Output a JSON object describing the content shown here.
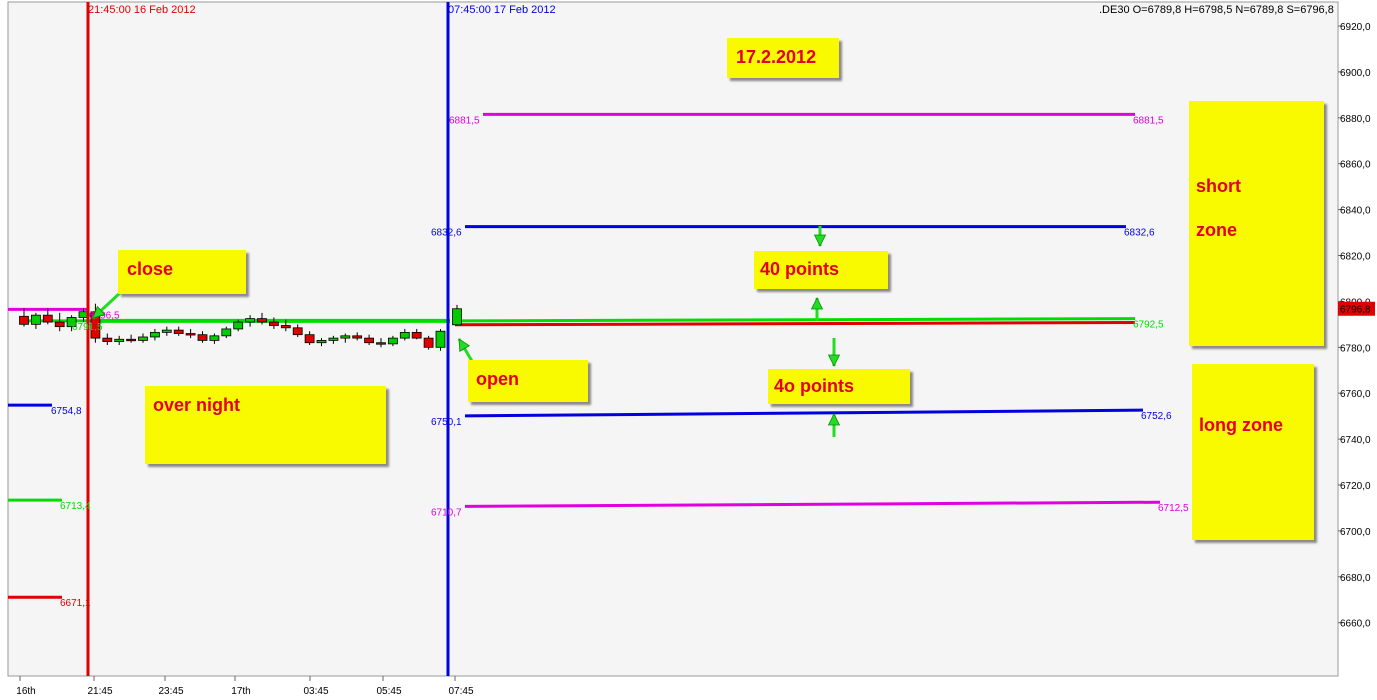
{
  "chart_data": {
    "type": "candlestick",
    "symbol_readout": ".DE30 O=6789,8 H=6798,5 N=6789,8 S=6796,8",
    "y_axis": {
      "ylim": [
        6638,
        6928
      ],
      "ticks": [
        "6920,0",
        "6900,0",
        "6880,0",
        "6860,0",
        "6840,0",
        "6820,0",
        "6800,0",
        "6780,0",
        "6760,0",
        "6740,0",
        "6720,0",
        "6700,0",
        "6680,0",
        "6660,0"
      ],
      "tick_values": [
        6920,
        6900,
        6880,
        6860,
        6840,
        6820,
        6800,
        6780,
        6760,
        6740,
        6720,
        6700,
        6680,
        6660
      ],
      "current_price_label": "6796,8",
      "current_price": 6796.8
    },
    "x_axis": {
      "ticks": [
        "16th",
        "21:45",
        "23:45",
        "17th",
        "03:45",
        "05:45",
        "07:45"
      ]
    },
    "vertical_markers": [
      {
        "label": "21:45:00 16 Feb 2012",
        "color": "#e00000"
      },
      {
        "label": "07:45:00 17 Feb 2012",
        "color": "#0000e0"
      }
    ],
    "levels_prev_day": [
      {
        "value": 6796.5,
        "label": "6796,5",
        "color": "#e000e0"
      },
      {
        "value": 6791.5,
        "label": "6791,5",
        "color": "#00dd00"
      },
      {
        "value": 6754.8,
        "label": "6754,8",
        "color": "#0000e0"
      },
      {
        "value": 6713.4,
        "label": "6713,4",
        "color": "#00dd00"
      },
      {
        "value": 6671.1,
        "label": "6671,1",
        "color": "#e00000"
      }
    ],
    "levels_today": [
      {
        "name": "magenta-upper",
        "start": 6881.5,
        "end": 6881.5,
        "start_label": "6881,5",
        "end_label": "6881,5",
        "color": "#e000e0"
      },
      {
        "name": "blue-upper",
        "start": 6832.6,
        "end": 6832.6,
        "start_label": "6832,6",
        "end_label": "6832,6",
        "color": "#0000e0"
      },
      {
        "name": "green-pivot",
        "start": 6791.5,
        "end": 6792.5,
        "start_label": "",
        "end_label": "6792,5",
        "color": "#00dd00"
      },
      {
        "name": "red-pivot",
        "start": 6789.8,
        "end": 6790.8,
        "start_label": "",
        "end_label": "",
        "color": "#e00000"
      },
      {
        "name": "blue-lower",
        "start": 6750.1,
        "end": 6752.6,
        "start_label": "6750,1",
        "end_label": "6752,6",
        "color": "#0000e0"
      },
      {
        "name": "magenta-lower",
        "start": 6710.7,
        "end": 6712.5,
        "start_label": "6710,7",
        "end_label": "6712,5",
        "color": "#e000e0"
      }
    ],
    "candles": [
      {
        "o": 6793.5,
        "h": 6797.0,
        "l": 6789.0,
        "c": 6790.0
      },
      {
        "o": 6790.0,
        "h": 6795.0,
        "l": 6788.0,
        "c": 6794.0
      },
      {
        "o": 6794.0,
        "h": 6797.0,
        "l": 6790.0,
        "c": 6791.0
      },
      {
        "o": 6791.0,
        "h": 6795.0,
        "l": 6787.0,
        "c": 6789.0
      },
      {
        "o": 6789.0,
        "h": 6794.0,
        "l": 6787.0,
        "c": 6793.0
      },
      {
        "o": 6793.0,
        "h": 6797.0,
        "l": 6791.0,
        "c": 6795.5
      },
      {
        "o": 6795.5,
        "h": 6799.0,
        "l": 6782.0,
        "c": 6784.0
      },
      {
        "o": 6784.0,
        "h": 6786.0,
        "l": 6781.0,
        "c": 6782.5
      },
      {
        "o": 6782.5,
        "h": 6785.0,
        "l": 6781.0,
        "c": 6783.5
      },
      {
        "o": 6783.5,
        "h": 6785.5,
        "l": 6782.0,
        "c": 6783.0
      },
      {
        "o": 6783.0,
        "h": 6786.0,
        "l": 6782.0,
        "c": 6784.5
      },
      {
        "o": 6784.5,
        "h": 6788.0,
        "l": 6783.0,
        "c": 6786.5
      },
      {
        "o": 6786.5,
        "h": 6789.0,
        "l": 6785.0,
        "c": 6787.5
      },
      {
        "o": 6787.5,
        "h": 6789.0,
        "l": 6785.0,
        "c": 6786.0
      },
      {
        "o": 6786.0,
        "h": 6788.0,
        "l": 6784.0,
        "c": 6785.5
      },
      {
        "o": 6785.5,
        "h": 6787.0,
        "l": 6782.0,
        "c": 6783.0
      },
      {
        "o": 6783.0,
        "h": 6786.0,
        "l": 6781.5,
        "c": 6785.0
      },
      {
        "o": 6785.0,
        "h": 6789.0,
        "l": 6784.0,
        "c": 6788.0
      },
      {
        "o": 6788.0,
        "h": 6792.0,
        "l": 6787.0,
        "c": 6791.0
      },
      {
        "o": 6791.0,
        "h": 6794.0,
        "l": 6789.0,
        "c": 6792.5
      },
      {
        "o": 6792.5,
        "h": 6795.0,
        "l": 6790.0,
        "c": 6791.0
      },
      {
        "o": 6791.0,
        "h": 6793.0,
        "l": 6788.0,
        "c": 6789.5
      },
      {
        "o": 6789.5,
        "h": 6792.0,
        "l": 6787.0,
        "c": 6788.5
      },
      {
        "o": 6788.5,
        "h": 6790.0,
        "l": 6784.5,
        "c": 6785.5
      },
      {
        "o": 6785.5,
        "h": 6787.0,
        "l": 6781.0,
        "c": 6782.0
      },
      {
        "o": 6782.0,
        "h": 6784.0,
        "l": 6780.5,
        "c": 6783.0
      },
      {
        "o": 6783.0,
        "h": 6785.0,
        "l": 6781.5,
        "c": 6784.0
      },
      {
        "o": 6784.0,
        "h": 6786.0,
        "l": 6782.0,
        "c": 6785.0
      },
      {
        "o": 6785.0,
        "h": 6786.5,
        "l": 6783.0,
        "c": 6784.0
      },
      {
        "o": 6784.0,
        "h": 6785.5,
        "l": 6781.0,
        "c": 6782.0
      },
      {
        "o": 6782.0,
        "h": 6784.0,
        "l": 6780.0,
        "c": 6781.5
      },
      {
        "o": 6781.5,
        "h": 6785.0,
        "l": 6780.5,
        "c": 6784.0
      },
      {
        "o": 6784.0,
        "h": 6788.0,
        "l": 6783.0,
        "c": 6786.5
      },
      {
        "o": 6786.5,
        "h": 6788.0,
        "l": 6783.5,
        "c": 6784.0
      },
      {
        "o": 6784.0,
        "h": 6785.0,
        "l": 6779.0,
        "c": 6780.0
      },
      {
        "o": 6780.0,
        "h": 6788.0,
        "l": 6778.5,
        "c": 6787.0
      },
      {
        "o": 6789.8,
        "h": 6798.5,
        "l": 6789.8,
        "c": 6796.8
      }
    ],
    "candle_colors": {
      "up": "#00cc00",
      "down": "#e00000"
    },
    "grid": false,
    "annotations": [
      {
        "key": "date",
        "text": "17.2.2012"
      },
      {
        "key": "close",
        "text": "close"
      },
      {
        "key": "open",
        "text": "open"
      },
      {
        "key": "over_night",
        "text": "over night"
      },
      {
        "key": "points_upper",
        "text": "40 points"
      },
      {
        "key": "points_lower",
        "text": "4o points"
      },
      {
        "key": "short_zone_1",
        "text": "short"
      },
      {
        "key": "short_zone_2",
        "text": "zone"
      },
      {
        "key": "long_zone",
        "text": "long   zone"
      }
    ]
  },
  "notes": {
    "date": "17.2.2012",
    "close": "close",
    "open": "open",
    "over_night": "over night",
    "points_upper": "40 points",
    "points_lower": "4o points",
    "short_line1": "short",
    "short_line2": "zone",
    "long_zone": "long   zone"
  },
  "colors": {
    "background": "#ffffff",
    "plot_background": "#f5f5f5",
    "note_fill": "#f9f900",
    "note_text": "#e4002b",
    "arrow": "#22dd22"
  }
}
